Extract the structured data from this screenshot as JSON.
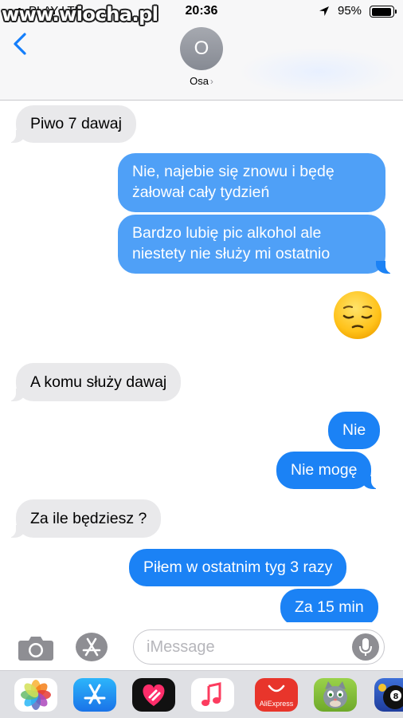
{
  "status_bar": {
    "carrier": "PLAY  LTE",
    "time": "20:36",
    "battery": "95%",
    "watermark": "www.wiocha.pl"
  },
  "header": {
    "avatar_initial": "O",
    "contact_name": "Osa",
    "contact_chevron": "›"
  },
  "messages": [
    {
      "direction": "incoming",
      "text": "Piwo 7 dawaj"
    },
    {
      "direction": "outgoing",
      "type": "text",
      "text": "Nie, najebie się znowu i będę żałował cały tydzień"
    },
    {
      "direction": "outgoing",
      "type": "text",
      "text": "Bardzo lubię pic alkohol ale niestety nie służy mi ostatnio"
    },
    {
      "direction": "outgoing",
      "type": "emoji",
      "text": "pensive-face-emoji"
    },
    {
      "direction": "incoming",
      "text": "A komu służy dawaj"
    },
    {
      "direction": "outgoing",
      "type": "text",
      "text": "Nie"
    },
    {
      "direction": "outgoing",
      "type": "text",
      "text": "Nie mogę"
    },
    {
      "direction": "incoming",
      "text": "Za ile będziesz ?"
    },
    {
      "direction": "outgoing",
      "type": "text",
      "text": "Piłem w ostatnim tyg 3 razy"
    },
    {
      "direction": "outgoing",
      "type": "text",
      "text": "Za 15 min"
    }
  ],
  "composer": {
    "placeholder": "iMessage",
    "camera_icon": "camera-icon",
    "apps_icon": "app-store-icon",
    "mic_icon": "microphone-icon"
  },
  "app_drawer": {
    "apps": [
      "photos-icon",
      "app-store-icon",
      "digital-touch-icon",
      "music-icon",
      "aliexpress-icon",
      "talking-tom-icon",
      "8-ball-pool-icon"
    ],
    "aliexpress_label": "AliExpress"
  },
  "colors": {
    "outgoing": "#1b82f5",
    "incoming": "#e9e9eb",
    "accent": "#147efb"
  }
}
